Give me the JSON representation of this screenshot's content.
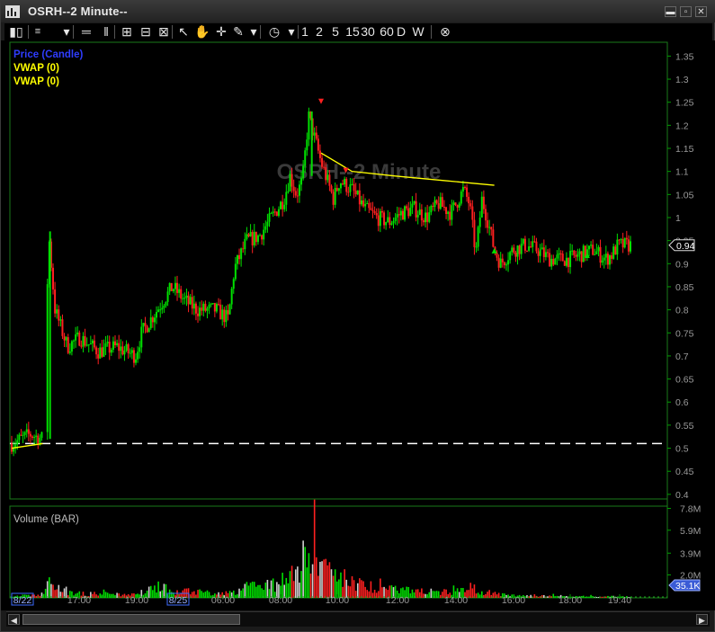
{
  "window": {
    "title": "OSRH--2 Minute--",
    "watermark": "OSRH--2 Minute"
  },
  "toolbar": {
    "intervals": [
      "1",
      "2",
      "5",
      "15",
      "30",
      "60",
      "D",
      "W"
    ],
    "icons": [
      "bar-style-icon",
      "dropdown-arrow-icon",
      "horizontal-lines-icon",
      "vertical-lines-icon",
      "zoom-in-icon",
      "zoom-out-icon",
      "zoom-fit-icon",
      "pointer-icon",
      "hand-icon",
      "crosshair-icon",
      "pencil-icon",
      "dropdown-arrow-icon",
      "clock-icon",
      "dropdown-arrow-icon",
      "close-circle-icon"
    ]
  },
  "price_panel": {
    "legend": [
      {
        "text": "Price (Candle)",
        "color": "#2f3dff"
      },
      {
        "text": "VWAP (0)",
        "color": "#ffff00"
      },
      {
        "text": "VWAP (0)",
        "color": "#ffff00"
      }
    ],
    "y_ticks": [
      "1.35",
      "1.3",
      "1.25",
      "1.2",
      "1.15",
      "1.1",
      "1.05",
      "1",
      "0.95",
      "0.9",
      "0.85",
      "0.8",
      "0.75",
      "0.7",
      "0.65",
      "0.6",
      "0.55",
      "0.5",
      "0.45",
      "0.4"
    ],
    "last_price_label": "0.94"
  },
  "volume_panel": {
    "legend": "Volume (BAR)",
    "y_ticks": [
      "7.8M",
      "5.9M",
      "3.9M",
      "2.0M"
    ],
    "last_volume_label": "35.1K"
  },
  "x_axis": {
    "labels": [
      {
        "text": "8/22",
        "boxed": true
      },
      {
        "text": "17:00",
        "boxed": false
      },
      {
        "text": "19:00",
        "boxed": false
      },
      {
        "text": "8/25",
        "boxed": true
      },
      {
        "text": "06:00",
        "boxed": false
      },
      {
        "text": "08:00",
        "boxed": false
      },
      {
        "text": "10:00",
        "boxed": false
      },
      {
        "text": "12:00",
        "boxed": false
      },
      {
        "text": "14:00",
        "boxed": false
      },
      {
        "text": "16:00",
        "boxed": false
      },
      {
        "text": "18:00",
        "boxed": false
      },
      {
        "text": "19:40",
        "boxed": false
      }
    ]
  },
  "colors": {
    "up": "#00e000",
    "down": "#ff2020",
    "vwap": "#ffff00",
    "dash": "#ffffff",
    "axis": "#00a000"
  },
  "chart_data": {
    "type": "candlestick",
    "symbol": "OSRH",
    "interval": "2 Minute",
    "price_ylim": [
      0.39,
      1.38
    ],
    "volume_ylim": [
      0,
      8000000
    ],
    "horizontal_line": 0.51,
    "close_path": [
      [
        0.0,
        0.51
      ],
      [
        0.03,
        0.53
      ],
      [
        0.05,
        0.52
      ],
      [
        0.06,
        0.96
      ],
      [
        0.07,
        0.8
      ],
      [
        0.09,
        0.72
      ],
      [
        0.11,
        0.74
      ],
      [
        0.14,
        0.71
      ],
      [
        0.17,
        0.72
      ],
      [
        0.2,
        0.7
      ],
      [
        0.21,
        0.75
      ],
      [
        0.23,
        0.79
      ],
      [
        0.26,
        0.85
      ],
      [
        0.28,
        0.82
      ],
      [
        0.3,
        0.8
      ],
      [
        0.33,
        0.8
      ],
      [
        0.35,
        0.78
      ],
      [
        0.36,
        0.89
      ],
      [
        0.38,
        0.95
      ],
      [
        0.4,
        0.96
      ],
      [
        0.42,
        1.0
      ],
      [
        0.44,
        1.04
      ],
      [
        0.45,
        1.09
      ],
      [
        0.46,
        1.05
      ],
      [
        0.47,
        1.08
      ],
      [
        0.48,
        1.22
      ],
      [
        0.5,
        1.12
      ],
      [
        0.52,
        1.04
      ],
      [
        0.53,
        1.08
      ],
      [
        0.55,
        1.06
      ],
      [
        0.57,
        1.02
      ],
      [
        0.59,
        1.0
      ],
      [
        0.61,
        0.99
      ],
      [
        0.63,
        1.01
      ],
      [
        0.65,
        1.02
      ],
      [
        0.67,
        1.0
      ],
      [
        0.69,
        1.03
      ],
      [
        0.71,
        1.01
      ],
      [
        0.73,
        1.06
      ],
      [
        0.74,
        1.03
      ],
      [
        0.75,
        0.92
      ],
      [
        0.76,
        1.04
      ],
      [
        0.77,
        0.99
      ],
      [
        0.78,
        0.93
      ],
      [
        0.79,
        0.9
      ],
      [
        0.81,
        0.93
      ],
      [
        0.83,
        0.94
      ],
      [
        0.85,
        0.93
      ],
      [
        0.87,
        0.91
      ],
      [
        0.9,
        0.91
      ],
      [
        0.92,
        0.92
      ],
      [
        0.94,
        0.93
      ],
      [
        0.96,
        0.91
      ],
      [
        0.97,
        0.92
      ],
      [
        0.98,
        0.94
      ]
    ],
    "vwap": [
      [
        0.0,
        0.5
      ],
      [
        0.05,
        0.51
      ],
      [
        0.5,
        1.14
      ],
      [
        0.55,
        1.1
      ],
      [
        0.62,
        1.09
      ],
      [
        0.7,
        1.08
      ],
      [
        0.78,
        1.07
      ]
    ],
    "markers": [
      {
        "x": 0.5,
        "price": 1.25,
        "type": "sell"
      },
      {
        "x": 0.54,
        "price": 1.1,
        "type": "sell"
      },
      {
        "x": 0.78,
        "price": 0.93,
        "type": "buy"
      },
      {
        "x": 0.93,
        "price": 0.92,
        "type": "buy"
      }
    ],
    "volume_profile": [
      [
        0.0,
        0.02
      ],
      [
        0.05,
        0.06
      ],
      [
        0.06,
        0.25
      ],
      [
        0.08,
        0.12
      ],
      [
        0.1,
        0.08
      ],
      [
        0.2,
        0.06
      ],
      [
        0.24,
        0.2
      ],
      [
        0.26,
        0.12
      ],
      [
        0.35,
        0.08
      ],
      [
        0.38,
        0.18
      ],
      [
        0.42,
        0.22
      ],
      [
        0.46,
        0.55
      ],
      [
        0.48,
        1.0
      ],
      [
        0.5,
        0.6
      ],
      [
        0.52,
        0.4
      ],
      [
        0.55,
        0.28
      ],
      [
        0.6,
        0.15
      ],
      [
        0.65,
        0.12
      ],
      [
        0.7,
        0.1
      ],
      [
        0.74,
        0.18
      ],
      [
        0.76,
        0.12
      ],
      [
        0.8,
        0.05
      ],
      [
        0.9,
        0.03
      ],
      [
        1.0,
        0.02
      ]
    ],
    "last_price": 0.94,
    "last_volume": "35.1K"
  }
}
